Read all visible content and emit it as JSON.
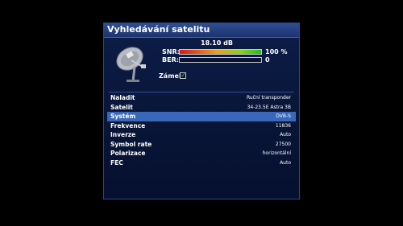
{
  "title": "Vyhledávání satelitu",
  "signal": {
    "db_value": "18.10 dB",
    "snr": {
      "label": "SNR:",
      "value_text": "100 %",
      "fraction": 1.0
    },
    "ber": {
      "label": "BER:",
      "value_text": "0",
      "fraction": 0.0
    }
  },
  "lock": {
    "label": "Zámek",
    "checked": true
  },
  "settings": [
    {
      "key": "Naladit",
      "value": "Ruční transponder"
    },
    {
      "key": "Satelit",
      "value": "34-23.5E Astra 3B"
    },
    {
      "key": "Systém",
      "value": "DVB-S"
    },
    {
      "key": "Frekvence",
      "value": "11836"
    },
    {
      "key": "Inverze",
      "value": "Auto"
    },
    {
      "key": "Symbol rate",
      "value": "27500"
    },
    {
      "key": "Polarizace",
      "value": "horizontální"
    },
    {
      "key": "FEC",
      "value": "Auto"
    }
  ],
  "selected_index": 2,
  "colors": {
    "panel": "#081536",
    "titlebar": "#1c3470",
    "selection": "#3a68b8",
    "check": "#28d828"
  },
  "icons": [
    "satellite-dish-icon",
    "checkmark-icon"
  ]
}
